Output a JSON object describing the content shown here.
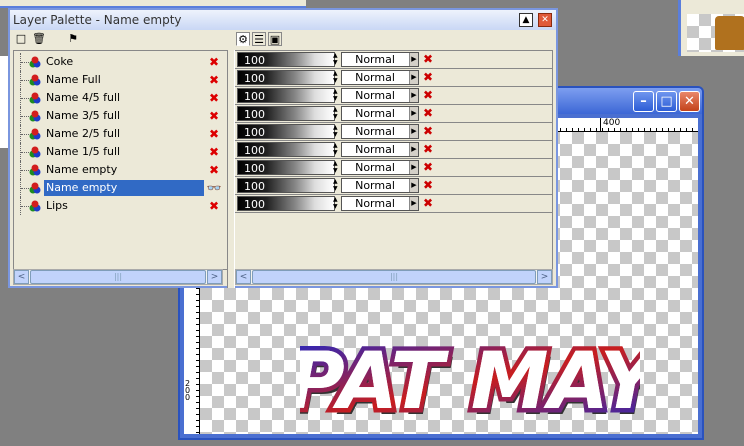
{
  "palette": {
    "title": "Layer Palette - Name empty",
    "minimize_icon": "▲",
    "close_icon": "✕",
    "toolbar_icons": [
      "□",
      "🗑",
      "⚑"
    ],
    "tab_icons": [
      "⚙",
      "☰",
      "▣"
    ],
    "layers": [
      {
        "name": "Coke",
        "opacity": "100",
        "blend": "Normal",
        "visible": false,
        "selected": false
      },
      {
        "name": "Name Full",
        "opacity": "100",
        "blend": "Normal",
        "visible": false,
        "selected": false
      },
      {
        "name": "Name 4/5 full",
        "opacity": "100",
        "blend": "Normal",
        "visible": false,
        "selected": false
      },
      {
        "name": "Name 3/5 full",
        "opacity": "100",
        "blend": "Normal",
        "visible": false,
        "selected": false
      },
      {
        "name": "Name 2/5 full",
        "opacity": "100",
        "blend": "Normal",
        "visible": false,
        "selected": false
      },
      {
        "name": "Name 1/5 full",
        "opacity": "100",
        "blend": "Normal",
        "visible": false,
        "selected": false
      },
      {
        "name": "Name empty",
        "opacity": "100",
        "blend": "Normal",
        "visible": false,
        "selected": false
      },
      {
        "name": "Name empty",
        "opacity": "100",
        "blend": "Normal",
        "visible": true,
        "selected": true
      },
      {
        "name": "Lips",
        "opacity": "100",
        "blend": "Normal",
        "visible": false,
        "selected": false
      }
    ],
    "visible_icon": "👓",
    "hidden_icon": "✖",
    "lock_icon": "✖",
    "blend_arrow": "▶",
    "scroll_left": "<",
    "scroll_right": ">",
    "scroll_grip": "|||"
  },
  "image_window": {
    "minimize": "–",
    "maximize": "□",
    "close": "✕",
    "ruler_h_label": "400",
    "ruler_v_label": "200",
    "artwork_text": "PAT MAY"
  },
  "colors": {
    "title_blue": "#3c67d6",
    "selection": "#316ac5",
    "art_red": "#c81e1e",
    "art_blue": "#1e28c8"
  }
}
